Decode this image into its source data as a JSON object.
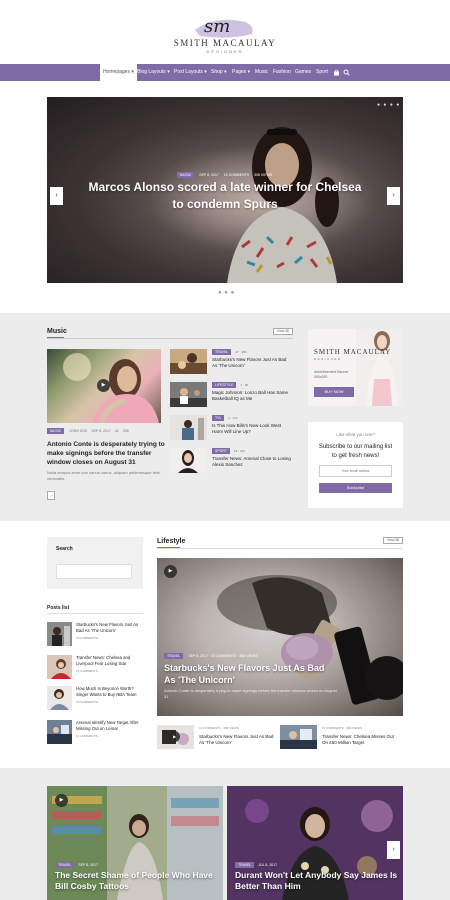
{
  "brand": {
    "script_logo": "sm",
    "name": "SMITH MACAULAY",
    "tagline": "DESIGNER"
  },
  "nav": {
    "items": [
      "Homepages ▾",
      "Blog Layouts ▾",
      "Post Layouts ▾",
      "Shop ▾",
      "Pages ▾",
      "Music",
      "Fashion",
      "Games",
      "Sport"
    ],
    "icons": [
      "bag-icon",
      "search-icon"
    ]
  },
  "hero": {
    "tag": "MUSIC",
    "date": "SEP 8, 2017",
    "comments": "10 COMMENTS",
    "views": "306 VIEWS",
    "title": "Marcos Alonso scored a late winner for Chelsea to condemn Spurs",
    "prev": "‹",
    "next": "›",
    "dots_top": "● ● ● ●",
    "dots_bottom": "● ● ●"
  },
  "music": {
    "title": "Music",
    "view_all": "View All",
    "main": {
      "tag": "MUSIC",
      "author": "JOHN DOE",
      "date": "SEP 8, 2017",
      "count_a": "42",
      "count_b": "306",
      "title": "Antonio Conte is desperately trying to make signings before the transfer window closes on August 31",
      "excerpt": "Nulla tempus enim non varius varius, aliquam pellentesque felis venenatis.",
      "more": "›"
    },
    "list": [
      {
        "tag": "TRAVEL",
        "meta": "27 · 386",
        "title": "Starbucks's New Flavors Just As Bad As 'The Unicorn'"
      },
      {
        "tag": "LIFESTYLE",
        "meta": "4 · 86",
        "title": "Magic Johnson: Lonzo Ball Has Same Basketball IQ as Me"
      },
      {
        "tag": "TVL",
        "meta": "4 · 172",
        "title": "Is This How Bills's New-Look West Harm Will Line Up?"
      },
      {
        "tag": "SPORT",
        "meta": "19 · 262",
        "title": "Transfer News: Arsenal Close to Losing Alexis Sanchez"
      }
    ]
  },
  "ad": {
    "name": "SMITH MACAULAY",
    "sub": "DESIGNER",
    "text": "Advertisement Banner 300x250",
    "button": "BUY NOW"
  },
  "newsletter": {
    "kicker": "Like what you see?",
    "title": "Subscribe to our mailing list to get fresh news!",
    "placeholder": "Your email adress",
    "button": "Subscribe"
  },
  "search": {
    "title": "Search"
  },
  "posts_list": {
    "title": "Posts list",
    "items": [
      {
        "title": "Starbucks's New Flavors Just As Bad As 'The Unicorn'",
        "meta": "10 COMMENTS"
      },
      {
        "title": "Transfer News: Chelsea and Liverpool Fear Losing Star",
        "meta": "10 COMMENTS"
      },
      {
        "title": "How Much Is Beyoncé Worth? Singer Wants to Buy NBA Team",
        "meta": "10 COMMENTS"
      },
      {
        "title": "Arsenal Identify New Target After Missing Out on Lemar",
        "meta": "10 COMMENTS"
      }
    ]
  },
  "lifestyle": {
    "title": "Lifestyle",
    "view_all": "View All",
    "main": {
      "tag": "TRAVEL",
      "meta": "SEP 8, 2017 · 10 COMMENTS · 386 VIEWS",
      "title": "Starbucks's New Flavors Just As Bad As 'The Unicorn'",
      "excerpt": "Antonio Conte is desperately trying to make signings before the transfer window closes on August 31"
    },
    "subs": [
      {
        "meta": "10 COMMENTS · 386 VIEWS",
        "title": "Starbucks's New Flavors Just As Bad As 'The Unicorn'"
      },
      {
        "meta": "10 COMMENTS · 306 VIEWS",
        "title": "Transfer News: Chelsea Misses Out On £50 Million Target"
      }
    ]
  },
  "bottom": [
    {
      "tag": "TRAVEL",
      "date": "SEP 8, 2017",
      "title": "The Secret Shame of People Who Have Bill Cosby Tattoos"
    },
    {
      "tag": "TRAVEL",
      "date": "JUL 8, 2017",
      "title": "Durant Won't Let Anybody Say James Is Better Than Him"
    }
  ],
  "colors": {
    "accent": "#7f6ba6",
    "band": "#ececec"
  }
}
